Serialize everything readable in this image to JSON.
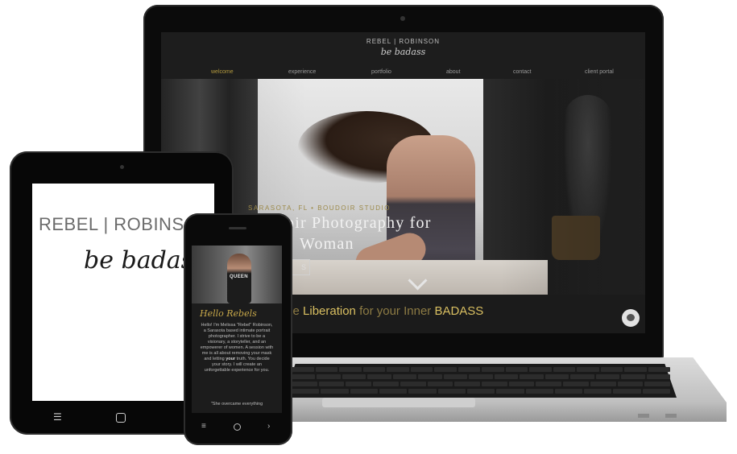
{
  "laptop": {
    "brand": "REBEL | ROBINSON",
    "brand_script": "be badass",
    "nav": [
      {
        "label": "welcome",
        "active": true
      },
      {
        "label": "experience",
        "active": false
      },
      {
        "label": "portfolio",
        "active": false
      },
      {
        "label": "about",
        "active": false
      },
      {
        "label": "contact",
        "active": false
      },
      {
        "label": "client portal",
        "active": false
      }
    ],
    "hero": {
      "eyebrow": "SARASOTA, FL • BOUDOIR STUDIO",
      "title_line1": "oir Photography for",
      "title_line2": "Woman",
      "button_fragment": "S"
    },
    "tagline_prefix": "xe ",
    "tagline_word1": "Liberation",
    "tagline_mid": " for your Inner ",
    "tagline_word2": "BADASS"
  },
  "tablet": {
    "brand": "REBEL | ROBINS",
    "brand_script": "be badass",
    "nav_icons": [
      "menu-icon",
      "home-square-icon"
    ]
  },
  "phone": {
    "shirt_text": "QUEEN",
    "greeting": "Hello Rebels",
    "body_pre": "Hello! I'm Melissa \"Rebel\" Robinson, a Sarasota based intimate portrait photographer. I strive to be a visionary, a storyteller, and an empowerer of women. A session with me is all about removing your mask and letting ",
    "body_em": "your",
    "body_post": " truth. You decide your story. I will create an unforgettable experience for you.",
    "body2": "\"She overcame everything",
    "nav_icons": [
      "menu-icon",
      "home-circle-icon",
      "back-chevron-icon"
    ]
  },
  "colors": {
    "gold": "#d9bf61",
    "gold_muted": "#8d7b44",
    "screen_bg": "#1b1b1b"
  }
}
